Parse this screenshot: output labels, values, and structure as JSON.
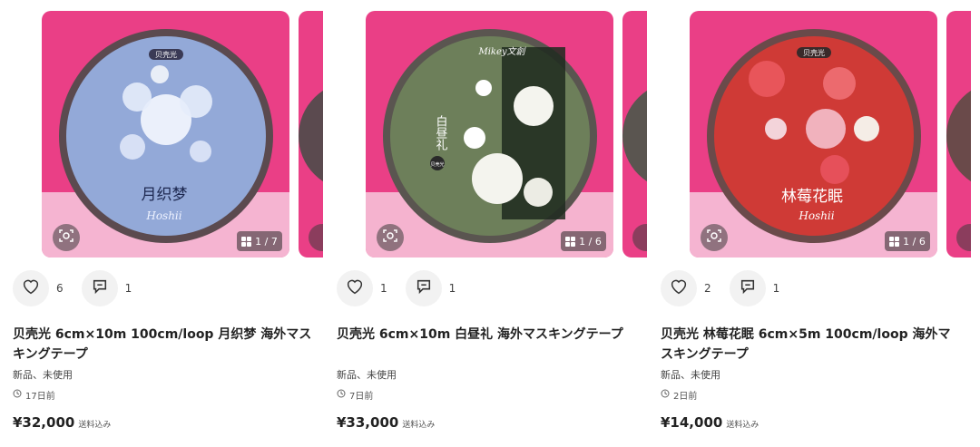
{
  "listings": [
    {
      "tape_label": "月织梦",
      "brand_label": "贝壳光",
      "logo_script": "Hoshii",
      "image_counter": "1 / 7",
      "likes": "6",
      "comments": "1",
      "title": "贝壳光 6cm×10m 100cm/loop 月织梦 海外マスキングテープ",
      "condition": "新品、未使用",
      "posted": "17日前",
      "price": "¥32,000",
      "shipping": "送料込み",
      "colors": {
        "background": "#ea3f86",
        "tape": "#93a9d8",
        "accent": "#f5f7ff"
      }
    },
    {
      "tape_label": "白昼礼",
      "brand_label": "贝壳光",
      "logo_script": "Mikey文創",
      "image_counter": "1 / 6",
      "likes": "1",
      "comments": "1",
      "title": "贝壳光 6cm×10m 白昼礼 海外マスキングテープ",
      "condition": "新品、未使用",
      "posted": "7日前",
      "price": "¥33,000",
      "shipping": "送料込み",
      "colors": {
        "background": "#ea3f86",
        "tape": "#6d7f5a",
        "accent": "#ffffff"
      }
    },
    {
      "tape_label": "林莓花眠",
      "brand_label": "贝壳光",
      "logo_script": "Hoshii",
      "image_counter": "1 / 6",
      "likes": "2",
      "comments": "1",
      "title": "贝壳光 林莓花眠 6cm×5m 100cm/loop 海外マスキングテープ",
      "condition": "新品、未使用",
      "posted": "2日前",
      "price": "¥14,000",
      "shipping": "送料込み",
      "colors": {
        "background": "#ea3f86",
        "tape": "#cf3a36",
        "accent": "#ffffff"
      }
    }
  ],
  "icons": {
    "like": "heart-outline-icon",
    "comment": "speech-bubble-icon",
    "time": "clock-icon",
    "lens": "image-search-icon",
    "counter": "grid-icon"
  }
}
